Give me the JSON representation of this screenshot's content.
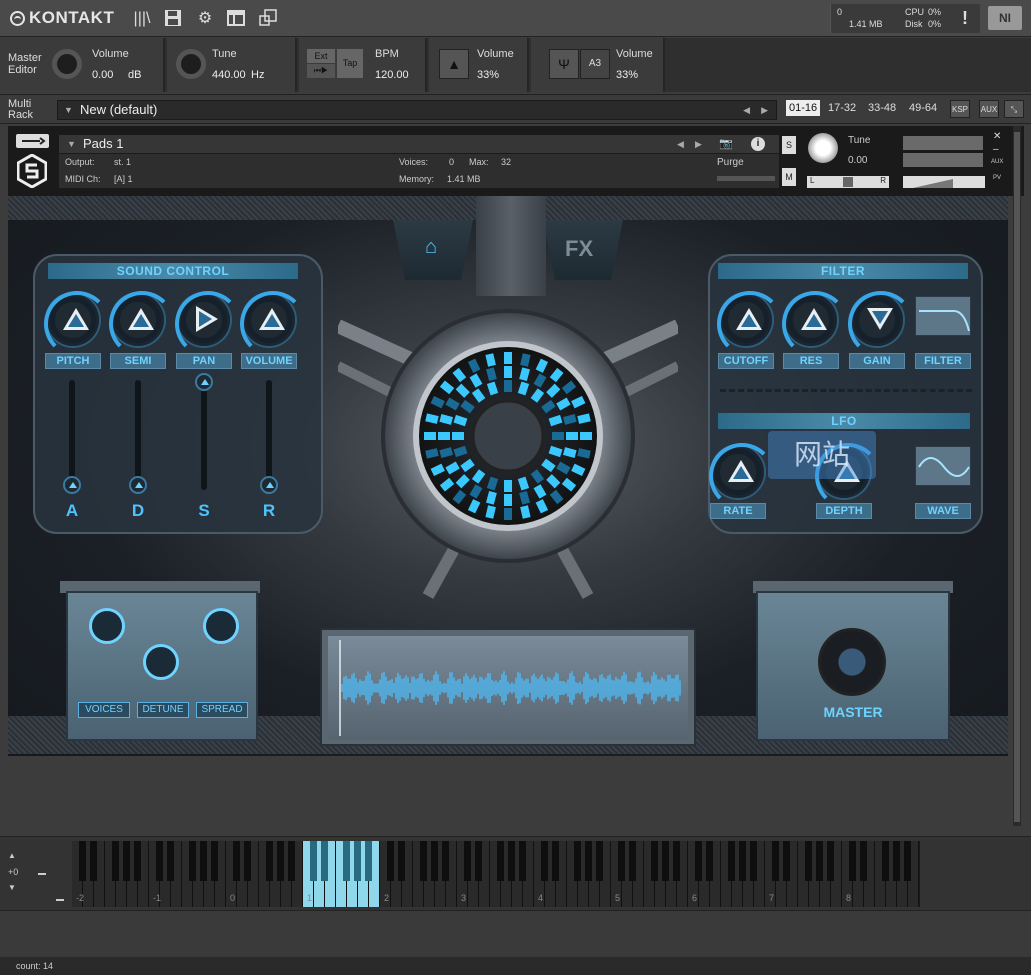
{
  "topbar": {
    "logo": "KONTAKT",
    "sys": {
      "voices": "0",
      "memory": "1.41 MB",
      "cpu_label": "CPU",
      "cpu": "0%",
      "disk_label": "Disk",
      "disk": "0%"
    },
    "warn": "!",
    "ni": "NI"
  },
  "master": {
    "editor_label": "Master Editor",
    "volume_label": "Volume",
    "volume_value": "0.00",
    "volume_unit": "dB",
    "tune_label": "Tune",
    "tune_value": "440.00",
    "tune_unit": "Hz",
    "ext_label": "Ext",
    "tap_label": "Tap",
    "bpm_label": "BPM",
    "bpm_value": "120.00",
    "metro_volume_label": "Volume",
    "metro_volume_value": "33%",
    "ref_label": "A3",
    "ref_volume_label": "Volume",
    "ref_volume_value": "33%"
  },
  "rack": {
    "label": "Multi Rack",
    "title": "New (default)",
    "ranges": [
      "01-16",
      "17-32",
      "33-48",
      "49-64"
    ],
    "ksp": "KSP",
    "aux": "AUX"
  },
  "instrument": {
    "name": "Pads 1",
    "output_label": "Output:",
    "output_value": "st. 1",
    "voices_label": "Voices:",
    "voices_value": "0",
    "max_label": "Max:",
    "max_value": "32",
    "midi_label": "MIDI Ch:",
    "midi_value": "[A]  1",
    "memory_label": "Memory:",
    "memory_value": "1.41 MB",
    "purge": "Purge",
    "tune_label": "Tune",
    "tune_value": "0.00",
    "s": "S",
    "m": "M",
    "l": "L",
    "r": "R",
    "aux": "AUX",
    "pv": "PV"
  },
  "panel": {
    "tab_fx": "FX",
    "sound_control": "SOUND CONTROL",
    "knobs_left": [
      "PITCH",
      "SEMI",
      "PAN",
      "VOLUME"
    ],
    "adsr": [
      "A",
      "D",
      "S",
      "R"
    ],
    "filter_title": "FILTER",
    "knobs_filter": [
      "CUTOFF",
      "RES",
      "GAIN",
      "FILTER"
    ],
    "lfo_title": "LFO",
    "knobs_lfo": [
      "RATE",
      "DEPTH",
      "WAVE"
    ],
    "unison": [
      "VOICES",
      "DETUNE",
      "SPREAD"
    ],
    "master": "MASTER",
    "watermark": "网站"
  },
  "keyboard": {
    "octave": "+0",
    "octaves": [
      "-2",
      "-1",
      "0",
      "1",
      "2",
      "3",
      "4",
      "5",
      "6",
      "7",
      "8"
    ]
  },
  "status": {
    "text": "count: 14"
  }
}
